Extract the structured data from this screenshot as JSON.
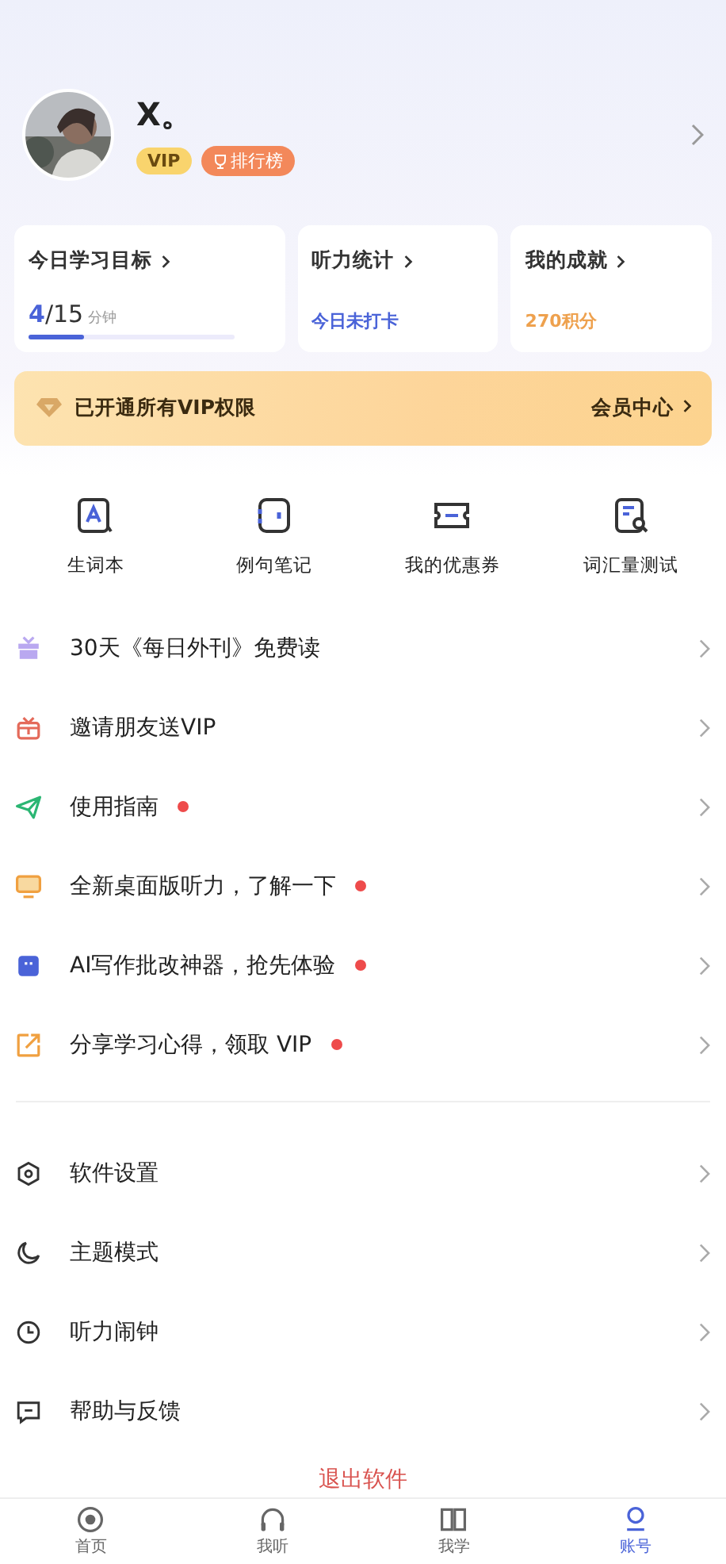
{
  "profile": {
    "name": "X。",
    "badges": [
      {
        "kind": "vip",
        "label": "VIP"
      },
      {
        "kind": "rank",
        "label": "排行榜"
      }
    ]
  },
  "stats": [
    {
      "kind": "goal",
      "title": "今日学习目标",
      "done": "4",
      "total": "/15",
      "unit": "分钟",
      "level": 0.27
    },
    {
      "kind": "status",
      "title": "听力统计",
      "value": "今日未打卡"
    },
    {
      "kind": "points",
      "title": "我的成就",
      "value": "270积分"
    }
  ],
  "vip_banner": {
    "text": "已开通所有VIP权限",
    "link": "会员中心"
  },
  "shortcuts": [
    {
      "kind": "wordbook",
      "label": "生词本"
    },
    {
      "kind": "notebook",
      "label": "例句笔记"
    },
    {
      "kind": "coupon",
      "label": "我的优惠券"
    },
    {
      "kind": "test",
      "label": "词汇量测试"
    }
  ],
  "menu": [
    {
      "kind": "gift",
      "label": "30天《每日外刊》免费读",
      "badge": false
    },
    {
      "kind": "giftbox",
      "label": "邀请朋友送VIP",
      "badge": false
    },
    {
      "kind": "plane",
      "label": "使用指南",
      "badge": true
    },
    {
      "kind": "monitor",
      "label": "全新桌面版听力，了解一下",
      "badge": true
    },
    {
      "kind": "robot",
      "label": "AI写作批改神器，抢先体验",
      "badge": true
    },
    {
      "kind": "share",
      "label": "分享学习心得，领取 VIP",
      "badge": true
    }
  ],
  "settings": [
    {
      "kind": "hexagon",
      "label": "软件设置"
    },
    {
      "kind": "moon",
      "label": "主题模式"
    },
    {
      "kind": "clock",
      "label": "听力闹钟"
    },
    {
      "kind": "chat",
      "label": "帮助与反馈"
    }
  ],
  "logout": "退出软件",
  "tabs": [
    {
      "kind": "home",
      "label": "首页",
      "selected": false
    },
    {
      "kind": "headphones",
      "label": "我听",
      "selected": false
    },
    {
      "kind": "book",
      "label": "我学",
      "selected": false
    },
    {
      "kind": "user",
      "label": "账号",
      "selected": true
    }
  ]
}
